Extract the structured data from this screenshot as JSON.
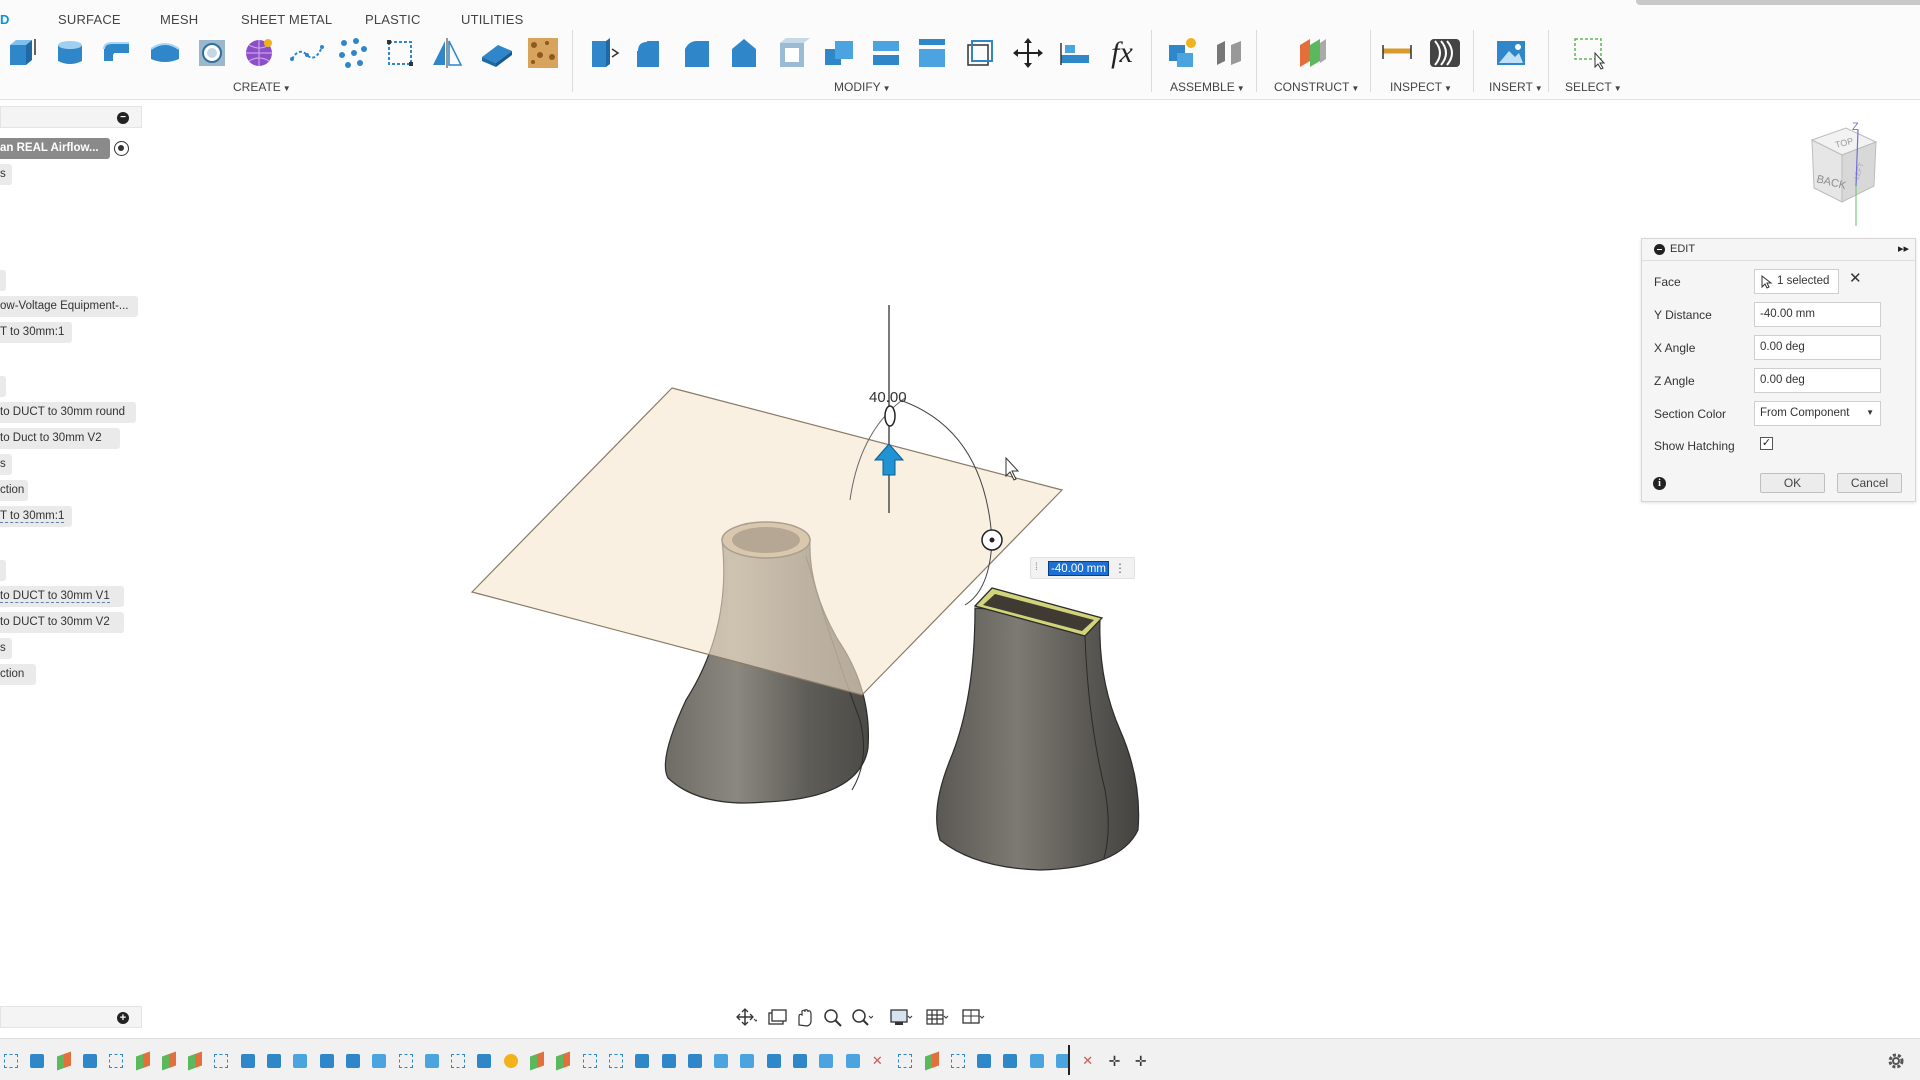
{
  "tabs": [
    {
      "label": "D",
      "active": true
    },
    {
      "label": "SURFACE"
    },
    {
      "label": "MESH"
    },
    {
      "label": "SHEET METAL"
    },
    {
      "label": "PLASTIC"
    },
    {
      "label": "UTILITIES"
    }
  ],
  "toolbar_groups": {
    "create": "CREATE",
    "modify": "MODIFY",
    "assemble": "ASSEMBLE",
    "construct": "CONSTRUCT",
    "inspect": "INSPECT",
    "insert": "INSERT",
    "select": "SELECT"
  },
  "toolbar_icons": {
    "create": [
      "extrude-icon",
      "revolve-icon",
      "sweep-icon",
      "loft-icon",
      "hole-icon",
      "form-icon",
      "spline-icon",
      "pattern-icon",
      "create-sketch-icon",
      "mirror-icon",
      "thicken-icon",
      "texture-icon"
    ],
    "modify": [
      "press-pull-icon",
      "fillet-icon",
      "chamfer-icon",
      "draft-icon",
      "shell-icon",
      "combine-icon",
      "split-body-icon",
      "split-face-icon",
      "scale-icon",
      "move-icon",
      "align-icon",
      "fx-parameters-icon"
    ],
    "assemble": [
      "new-component-icon",
      "joint-icon"
    ],
    "construct": [
      "offset-plane-icon"
    ],
    "inspect": [
      "measure-icon",
      "zebra-analysis-icon"
    ],
    "insert": [
      "insert-image-icon"
    ],
    "select": [
      "select-window-icon"
    ]
  },
  "fx_label": "fx",
  "browser": {
    "items": [
      {
        "text": "an REAL Airflow...",
        "style": "dark"
      },
      {
        "text": "s"
      },
      {
        "text": ""
      },
      {
        "text": "ow-Voltage Equipment-..."
      },
      {
        "text": "T to 30mm:1"
      },
      {
        "text": ""
      },
      {
        "text": "to DUCT to 30mm round"
      },
      {
        "text": "to Duct to 30mm V2"
      },
      {
        "text": "s"
      },
      {
        "text": "ction"
      },
      {
        "text": "T to 30mm:1",
        "style": "dashed"
      },
      {
        "text": ""
      },
      {
        "text": "to DUCT to 30mm V1",
        "style": "dashed"
      },
      {
        "text": "to DUCT to 30mm V2"
      },
      {
        "text": "s"
      },
      {
        "text": "ction"
      }
    ]
  },
  "viewcube": {
    "face_top": "TOP",
    "face_back": "BACK",
    "face_side": "LEFT",
    "axis_z": "Z"
  },
  "dimension_label": "40.00",
  "edit_dialog": {
    "title": "EDIT",
    "face_label": "Face",
    "face_value": "1 selected",
    "y_distance_label": "Y Distance",
    "y_distance_value": "-40.00 mm",
    "x_angle_label": "X Angle",
    "x_angle_value": "0.00 deg",
    "z_angle_label": "Z Angle",
    "z_angle_value": "0.00 deg",
    "section_color_label": "Section Color",
    "section_color_value": "From Component",
    "show_hatching_label": "Show Hatching",
    "show_hatching": true,
    "ok_label": "OK",
    "cancel_label": "Cancel"
  },
  "dim_input_value": "-40.00 mm",
  "colors": {
    "accent": "#0696d7",
    "plane": "#f7e7cf",
    "body": "#5e5b55",
    "dim_highlight": "#1d6fd1"
  }
}
